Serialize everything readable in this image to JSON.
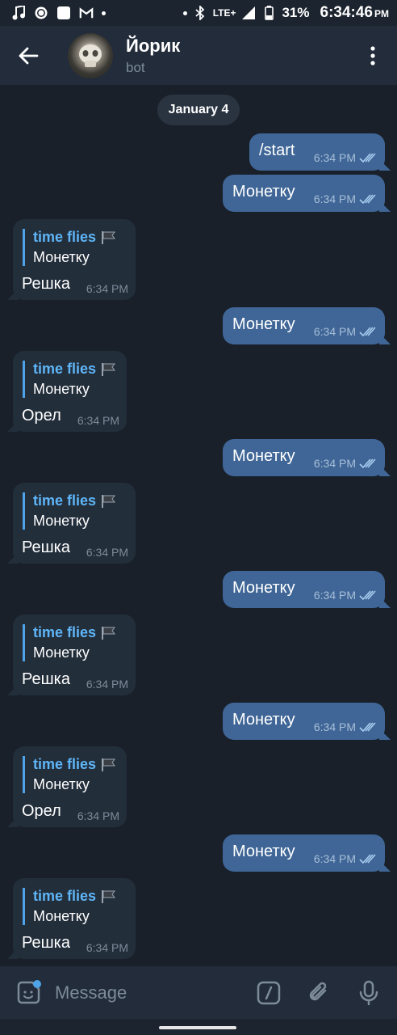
{
  "status_bar": {
    "battery": "31%",
    "time": "6:34:46",
    "ampm": "PM",
    "network": "LTE+"
  },
  "header": {
    "title": "Йорик",
    "subtitle": "bot"
  },
  "date_separator": "January 4",
  "messages": [
    {
      "dir": "out",
      "text": "/start",
      "time": "6:34 PM"
    },
    {
      "dir": "out",
      "text": "Монетку",
      "time": "6:34 PM"
    },
    {
      "dir": "in",
      "quote_name": "time flies",
      "quote_text": "Монетку",
      "text": "Решка",
      "time": "6:34 PM"
    },
    {
      "dir": "out",
      "text": "Монетку",
      "time": "6:34 PM"
    },
    {
      "dir": "in",
      "quote_name": "time flies",
      "quote_text": "Монетку",
      "text": "Орел",
      "time": "6:34 PM"
    },
    {
      "dir": "out",
      "text": "Монетку",
      "time": "6:34 PM"
    },
    {
      "dir": "in",
      "quote_name": "time flies",
      "quote_text": "Монетку",
      "text": "Решка",
      "time": "6:34 PM"
    },
    {
      "dir": "out",
      "text": "Монетку",
      "time": "6:34 PM"
    },
    {
      "dir": "in",
      "quote_name": "time flies",
      "quote_text": "Монетку",
      "text": "Решка",
      "time": "6:34 PM"
    },
    {
      "dir": "out",
      "text": "Монетку",
      "time": "6:34 PM"
    },
    {
      "dir": "in",
      "quote_name": "time flies",
      "quote_text": "Монетку",
      "text": "Орел",
      "time": "6:34 PM"
    },
    {
      "dir": "out",
      "text": "Монетку",
      "time": "6:34 PM"
    },
    {
      "dir": "in",
      "quote_name": "time flies",
      "quote_text": "Монетку",
      "text": "Решка",
      "time": "6:34 PM"
    }
  ],
  "composer": {
    "placeholder": "Message"
  },
  "colors": {
    "background": "#19202a",
    "header": "#222c3a",
    "outgoing_bubble": "#3f6696",
    "incoming_bubble": "#232e3b",
    "accent": "#5eb5f7"
  }
}
